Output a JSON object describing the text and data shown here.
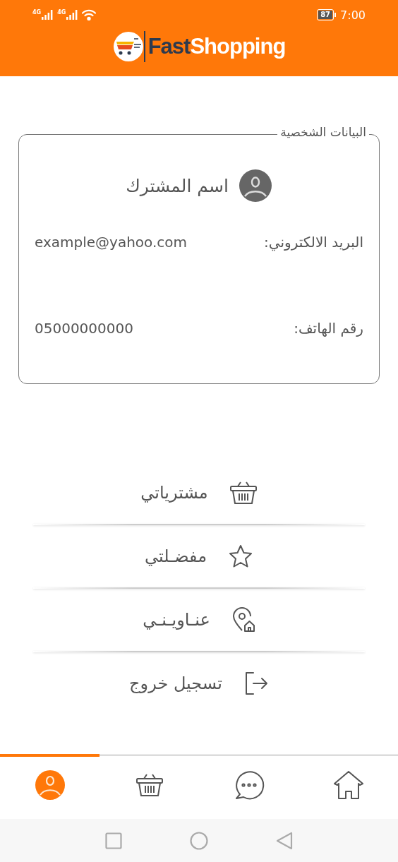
{
  "status_bar": {
    "sim_1_network": "4G",
    "sim_2_network": "4G",
    "battery": "87",
    "time": "7:00"
  },
  "header": {
    "logo_dark_part": "Fast",
    "logo_light_part": "Shopping"
  },
  "profile_card": {
    "legend": "البيانات الشخصية",
    "name": "اسم المشترك",
    "fields": [
      {
        "label": "البريد الالكتروني:",
        "value": "example@yahoo.com"
      },
      {
        "label": "رقم الهاتف:",
        "value": "05000000000"
      }
    ]
  },
  "menu": [
    {
      "kind": "basket",
      "label": "مشترياتي"
    },
    {
      "kind": "star",
      "label": "مفضـلتي"
    },
    {
      "kind": "address",
      "label": "عنـاويـنـي"
    },
    {
      "kind": "logout",
      "label": "تسجيل خروج"
    }
  ],
  "bottom_nav": [
    {
      "kind": "profile",
      "selected": true
    },
    {
      "kind": "basket",
      "selected": false
    },
    {
      "kind": "chat",
      "selected": false
    },
    {
      "kind": "home",
      "selected": false
    }
  ]
}
